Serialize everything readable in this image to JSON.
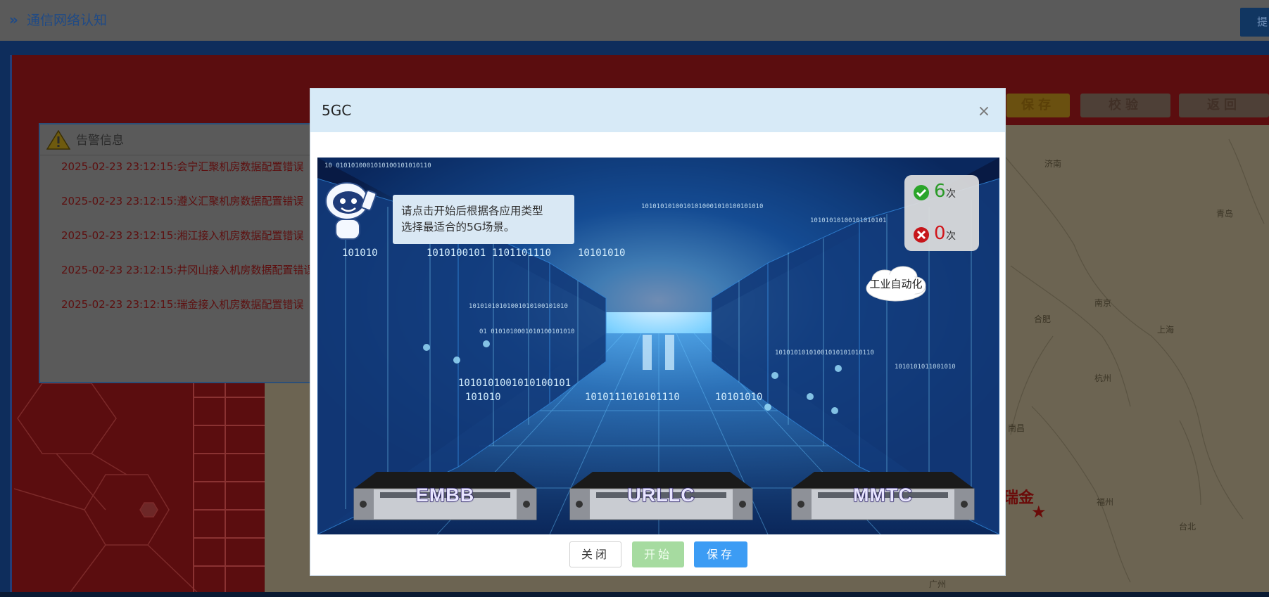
{
  "header": {
    "title": "通信网络认知",
    "submit_label": "提"
  },
  "toolbar": {
    "save": "保存",
    "check": "校验",
    "back": "返回"
  },
  "alert_panel": {
    "title": "告警信息",
    "items": [
      "2025-02-23 23:12:15:会宁汇聚机房数据配置错误",
      "2025-02-23 23:12:15:遵义汇聚机房数据配置错误",
      "2025-02-23 23:12:15:湘江接入机房数据配置错误",
      "2025-02-23 23:12:15:井冈山接入机房数据配置错误",
      "2025-02-23 23:12:15:瑞金接入机房数据配置错误"
    ]
  },
  "map": {
    "cities": [
      "济南",
      "南京",
      "合肥",
      "上海",
      "杭州",
      "南昌",
      "福州",
      "台北",
      "广州",
      "青岛"
    ],
    "highlight_city": "瑞金"
  },
  "modal": {
    "title": "5GC",
    "close_symbol": "×",
    "hint_lines": [
      "请点击开始后根据各应用类型",
      "选择最适合的5G场景。"
    ],
    "score": {
      "correct": "6",
      "wrong": "0",
      "unit": "次"
    },
    "cloud_label": "工业自动化",
    "servers": [
      "EMBB",
      "URLLC",
      "MMTC"
    ],
    "buttons": {
      "close": "关闭",
      "start": "开始",
      "save": "保存"
    }
  },
  "colors": {
    "accent": "#3c9cf4",
    "start_disabled": "#a6dba0",
    "modal_header": "#d7eaf7",
    "correct": "#2a9a28",
    "wrong": "#d0161b"
  }
}
